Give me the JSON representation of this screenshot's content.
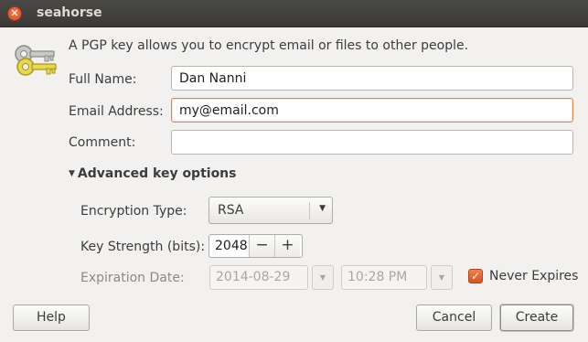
{
  "window": {
    "title": "seahorse"
  },
  "icons": {
    "close": "close-icon",
    "keys": "keys-icon",
    "expander": "triangle-down-icon",
    "spin_down": "minus-icon",
    "spin_up": "plus-icon",
    "checkbox": "checkmark-icon"
  },
  "intro": "A PGP key allows you to encrypt email or files to other people.",
  "form": {
    "full_name": {
      "label": "Full Name:",
      "value": "Dan Nanni"
    },
    "email": {
      "label": "Email Address:",
      "value": "my@email.com"
    },
    "comment": {
      "label": "Comment:",
      "value": ""
    }
  },
  "advanced": {
    "label": "Advanced key options",
    "encryption_type": {
      "label": "Encryption Type:",
      "value": "RSA"
    },
    "key_strength": {
      "label": "Key Strength (bits):",
      "value": "2048",
      "minus": "−",
      "plus": "+"
    },
    "expiration": {
      "label": "Expiration Date:",
      "date": "2014-08-29",
      "time": "10:28 PM",
      "never_expires_label": "Never Expires",
      "never_expires_checked": true
    }
  },
  "buttons": {
    "help": "Help",
    "cancel": "Cancel",
    "create": "Create"
  },
  "colors": {
    "accent": "#e6844f",
    "titlebar": "#3c3b37"
  }
}
